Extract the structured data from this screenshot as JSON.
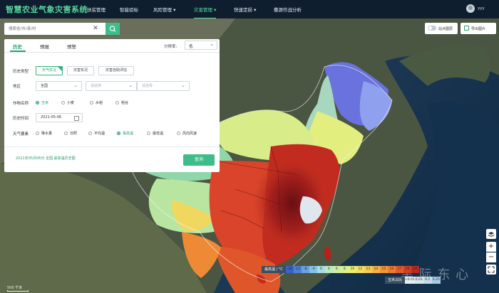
{
  "app": {
    "title": "智慧农业气象灾害系统",
    "user": "yyy"
  },
  "nav": [
    {
      "label": "扶贫管理"
    },
    {
      "label": "智能验标"
    },
    {
      "label": "风险管理 ▾"
    },
    {
      "label": "灾害管理 ▾",
      "active": true
    },
    {
      "label": "快速定损 ▾"
    },
    {
      "label": "撒源作战分析"
    }
  ],
  "search": {
    "placeholder": "搜索省/市/县/村",
    "clear": "✕"
  },
  "panel": {
    "tabs": [
      "历史",
      "预报",
      "预警"
    ],
    "resolution_label": "分辨率:",
    "resolution_value": "低",
    "history_type_label": "历史类型",
    "history_types": [
      "天气实况",
      "灾害实况",
      "灾害自助评估"
    ],
    "region_label": "地区",
    "region_values": [
      "全国",
      "请选择",
      "请选择"
    ],
    "crop_label": "作物名称",
    "crops": [
      "玉米",
      "小麦",
      "水稻",
      "稻谷"
    ],
    "time_label": "历史时间",
    "date_value": "2021-05-06",
    "element_label": "天气要素",
    "elements": [
      "降水量",
      "日照",
      "平均温",
      "最高温",
      "最低温",
      "风向风速"
    ],
    "summary": "2021年05月06日 全国 最高温历史图",
    "query_button": "查询"
  },
  "tools": {
    "grid_toggle": "站点图层",
    "export": "导出图片"
  },
  "map": {
    "scale": "500 千米",
    "legend_temp_title": "最高温 / °C",
    "legend_temp_values": [
      "-16",
      "-12",
      "-8",
      "-4",
      "0",
      "4",
      "6",
      "8",
      "10",
      "12",
      "13",
      "14",
      "15",
      "16",
      "17",
      "18",
      "19"
    ],
    "legend_temp_colors": [
      "#3b62c8",
      "#4f80d8",
      "#6aa0e0",
      "#87c0e6",
      "#a8dce0",
      "#bde8c0",
      "#cdeea0",
      "#ddf08a",
      "#eaf070",
      "#f4e060",
      "#f7cc50",
      "#f6b244",
      "#f39638",
      "#ef7a30",
      "#e65a28",
      "#d63e22",
      "#c0281e"
    ],
    "legend_risk_title": "玉米占比",
    "legend_risk_values": [
      "<0.01",
      "0.01",
      "0.1",
      "0.25"
    ],
    "legend_risk_colors": [
      "#e8eef2",
      "#d8e6ee",
      "#c6dcea",
      "#a8cce4"
    ],
    "watermark": "黑 际 东 心"
  }
}
